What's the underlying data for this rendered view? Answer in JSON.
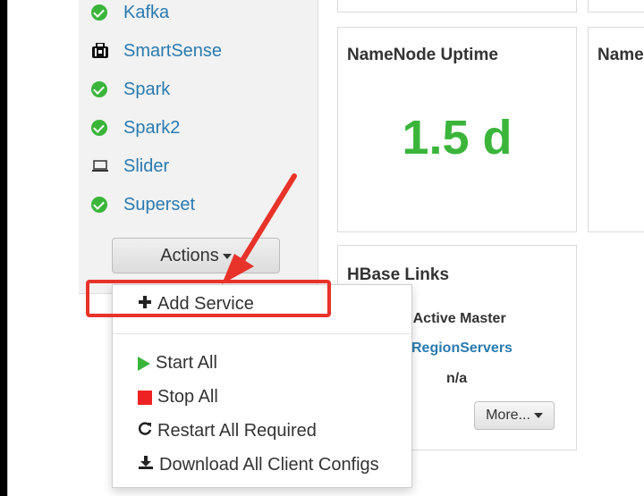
{
  "sidebar": {
    "services": [
      {
        "label": "Kafka",
        "icon": "check-circle-icon",
        "status_color": "#3ab53a"
      },
      {
        "label": "SmartSense",
        "icon": "briefcase-icon"
      },
      {
        "label": "Spark",
        "icon": "check-circle-icon",
        "status_color": "#3ab53a"
      },
      {
        "label": "Spark2",
        "icon": "check-circle-icon",
        "status_color": "#3ab53a"
      },
      {
        "label": "Slider",
        "icon": "laptop-icon"
      },
      {
        "label": "Superset",
        "icon": "check-circle-icon",
        "status_color": "#3ab53a"
      }
    ],
    "actions_label": "Actions"
  },
  "widgets": {
    "namenode_uptime": {
      "title": "NameNode Uptime",
      "value": "1.5 d",
      "value_color": "#3ab53a"
    },
    "partial_title": "Name",
    "hbase_links": {
      "title": "HBase Links",
      "active_master": "o Active Master",
      "region_servers": "RegionServers",
      "na": "n/a",
      "more_label": "More..."
    }
  },
  "actions_menu": {
    "items": [
      {
        "label": "Add Service",
        "icon": "plus-icon"
      },
      {
        "label": "Start All",
        "icon": "play-icon",
        "color": "#3ab53a"
      },
      {
        "label": "Stop All",
        "icon": "stop-icon",
        "color": "#ee2222"
      },
      {
        "label": "Restart All Required",
        "icon": "refresh-icon"
      },
      {
        "label": "Download All Client Configs",
        "icon": "download-icon"
      }
    ]
  },
  "annotation": {
    "color": "#e8332a"
  }
}
